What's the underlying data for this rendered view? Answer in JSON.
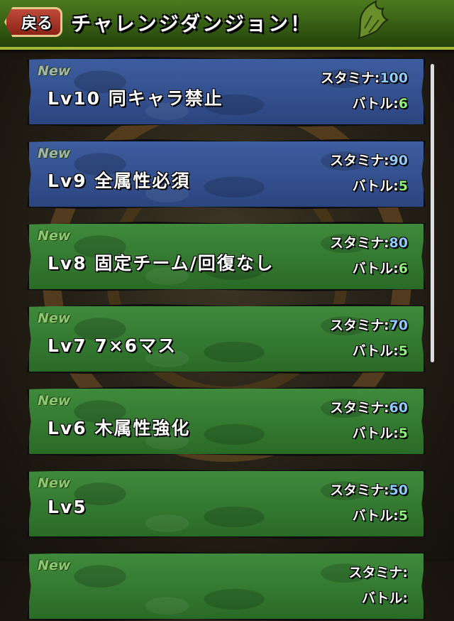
{
  "header": {
    "back_label": "戻る",
    "title": "チャレンジダンジョン！"
  },
  "list": {
    "new_badge": "New",
    "stamina_label": "スタミナ:",
    "battle_label": "バトル:",
    "items": [
      {
        "name": "Lv10 同キャラ禁止",
        "stamina": "100",
        "battles": "6",
        "theme": "blue"
      },
      {
        "name": "Lv9 全属性必須",
        "stamina": "90",
        "battles": "5",
        "theme": "blue"
      },
      {
        "name": "Lv8 固定チーム/回復なし",
        "stamina": "80",
        "battles": "6",
        "theme": "green"
      },
      {
        "name": "Lv7 7×6マス",
        "stamina": "70",
        "battles": "5",
        "theme": "green"
      },
      {
        "name": "Lv6 木属性強化",
        "stamina": "60",
        "battles": "5",
        "theme": "green"
      },
      {
        "name": "Lv5",
        "stamina": "50",
        "battles": "5",
        "theme": "green"
      },
      {
        "name": "",
        "stamina": "",
        "battles": "",
        "theme": "green"
      }
    ]
  },
  "colors": {
    "blue_card": "#34508f",
    "green_card": "#357a32",
    "stamina_number": "#8ecbff",
    "battle_number": "#8ef07a"
  },
  "icons": {
    "header_decoration": "dragon-wing-icon"
  }
}
